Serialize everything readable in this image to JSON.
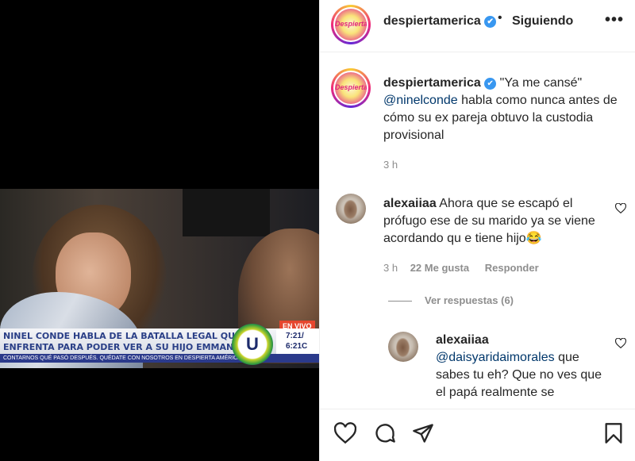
{
  "media": {
    "live_badge": "EN VIVO",
    "headline_line1": "NINEL CONDE HABLA DE LA BATALLA LEGAL QUE",
    "headline_line2": "ENFRENTA PARA PODER VER A SU HIJO EMMANUEL",
    "ticker": "CONTARNOS QUÉ PASÓ DESPUÉS. QUÉDATE CON NOSOTROS EN DESPIERTA AMÉRICA",
    "time": "7:21/",
    "temperature": "6:21C",
    "network_logo": "U"
  },
  "header": {
    "avatar_logo": "Despierta",
    "username": "despiertamerica",
    "verified_mark": "✔",
    "separator": "•",
    "follow_label": "Siguiendo",
    "more_label": "•••"
  },
  "caption": {
    "username": "despiertamerica",
    "text_before": " \"Ya me cansé\" ",
    "mention": "@ninelconde",
    "text_after": " habla como nunca antes de cómo su ex pareja obtuvo la custodia provisional",
    "time": "3 h"
  },
  "comment1": {
    "username": "alexaiiaa",
    "text": " Ahora que se escapó el prófugo ese de su marido ya se viene acordando qu e tiene hijo",
    "emoji": "😂",
    "time": "3 h",
    "likes": "22 Me gusta",
    "reply_label": "Responder",
    "view_replies": "Ver respuestas (6)"
  },
  "comment2": {
    "username": "alexaiiaa",
    "mention": "@daisyaridaimorales",
    "text": " que sabes tu eh? Que no ves que el papá realmente se"
  },
  "colors": {
    "verified": "#3897f0",
    "mention": "#00376b",
    "muted": "#8e8e8e",
    "text": "#262626"
  }
}
